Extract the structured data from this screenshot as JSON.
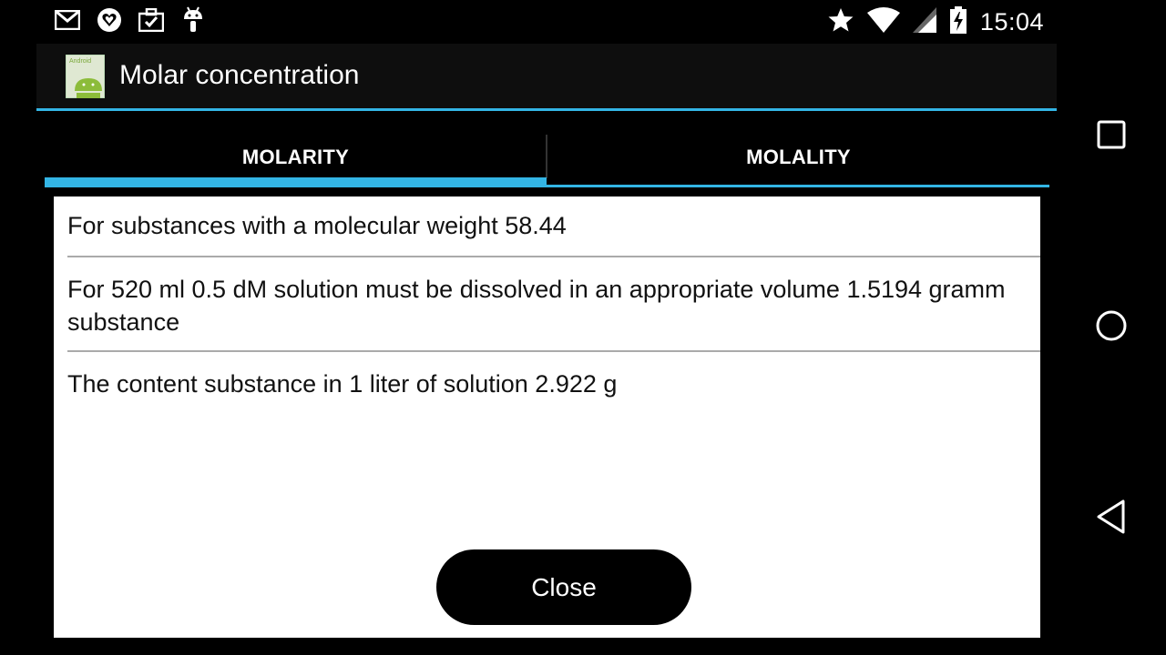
{
  "status_bar": {
    "time": "15:04",
    "left_icons": [
      "gmail-icon",
      "gift-heart-icon",
      "briefcase-check-icon",
      "android-debug-icon"
    ],
    "right_icons": [
      "star-icon",
      "wifi-icon",
      "signal-icon",
      "battery-charging-icon"
    ]
  },
  "action_bar": {
    "title": "Molar concentration",
    "icon": "android-app-icon"
  },
  "tabs": [
    {
      "label": "MOLARITY",
      "selected": true
    },
    {
      "label": "MOLALITY",
      "selected": false
    }
  ],
  "dialog": {
    "lines": [
      "For substances with a molecular weight 58.44",
      "For 520 ml 0.5 dM solution must be dissolved in an appropriate volume 1.5194 gramm substance",
      "The content substance in 1 liter of solution 2.922 g"
    ],
    "close_label": "Close"
  },
  "nav_bar": {
    "buttons": [
      "recent-apps-icon",
      "home-icon",
      "back-icon"
    ]
  },
  "colors": {
    "accent": "#33b5e5",
    "background": "#000000",
    "dialog_bg": "#ffffff"
  }
}
